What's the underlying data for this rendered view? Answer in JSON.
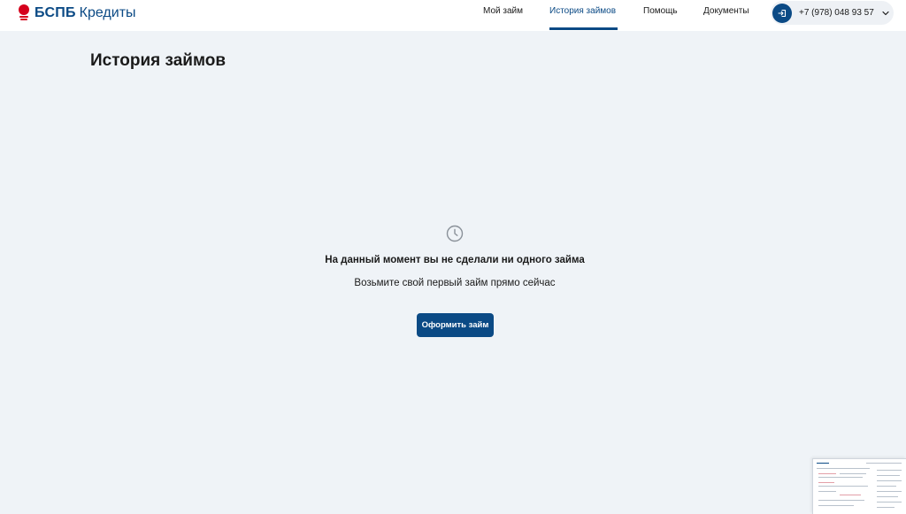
{
  "header": {
    "logo_brand": "БСПБ",
    "logo_sub": "Кредиты",
    "nav": [
      {
        "label": "Мой займ",
        "active": false
      },
      {
        "label": "История займов",
        "active": true
      },
      {
        "label": "Помощь",
        "active": false
      },
      {
        "label": "Документы",
        "active": false
      }
    ],
    "account": {
      "phone": "+7 (978) 048 93 57",
      "icon": "login-icon",
      "chevron": "chevron-down-icon"
    }
  },
  "main": {
    "title": "История займов",
    "empty_state": {
      "icon": "clock-icon",
      "title": "На данный момент вы не сделали ни одного займа",
      "subtitle": "Возьмите свой первый займ прямо сейчас",
      "cta_label": "Оформить займ"
    }
  },
  "colors": {
    "brand": "#0b4a85",
    "logo_red": "#d5001c",
    "background": "#eff3f7"
  }
}
